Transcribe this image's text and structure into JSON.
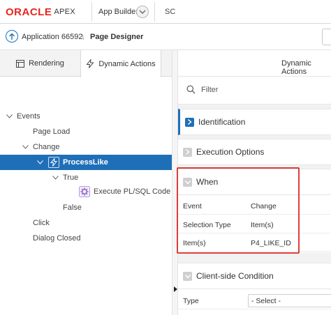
{
  "header": {
    "logo_oracle": "ORACLE",
    "logo_apex": "APEX",
    "app_builder": "App Builder",
    "sql_tab": "SC"
  },
  "breadcrumb": {
    "application": "Application 66592",
    "separator": "\\",
    "page": "Page Designer"
  },
  "left_tabs": {
    "rendering": "Rendering",
    "dynamic_actions": "Dynamic Actions"
  },
  "tree": {
    "events": "Events",
    "page_load": "Page Load",
    "change": "Change",
    "process_like": "ProcessLike",
    "true": "True",
    "execute": "Execute PL/SQL Code",
    "false": "False",
    "click": "Click",
    "dialog_closed": "Dialog Closed"
  },
  "right": {
    "header": "Dynamic Actions",
    "filter_placeholder": "Filter",
    "sections": {
      "identification": "Identification",
      "execution_options": "Execution Options",
      "when": "When",
      "client_side": "Client-side Condition"
    },
    "when_props": [
      {
        "label": "Event",
        "value": "Change"
      },
      {
        "label": "Selection Type",
        "value": "Item(s)"
      },
      {
        "label": "Item(s)",
        "value": "P4_LIKE_ID"
      }
    ],
    "client_props": {
      "type_label": "Type",
      "type_value": "- Select -"
    }
  },
  "colors": {
    "oracle_red": "#e8251d",
    "selection_blue": "#1f6fb8",
    "highlight_red": "#e03c3c"
  }
}
